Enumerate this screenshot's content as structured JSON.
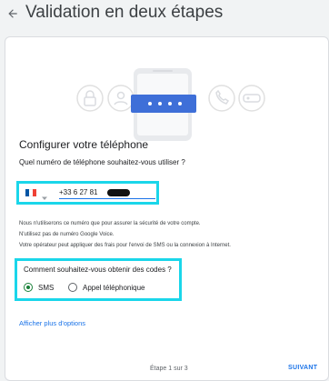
{
  "header": {
    "title": "Validation en deux étapes"
  },
  "setup": {
    "section_title": "Configurer votre téléphone",
    "question": "Quel numéro de téléphone souhaitez-vous utiliser ?",
    "country_flag": "france-flag-icon",
    "phone_value": "+33 6 27 81"
  },
  "info_lines": [
    "Nous n'utiliserons ce numéro que pour assurer la sécurité de votre compte.",
    "N'utilisez pas de numéro Google Voice.",
    "Votre opérateur peut appliquer des frais pour l'envoi de SMS ou la connexion à Internet."
  ],
  "codes": {
    "question": "Comment souhaitez-vous obtenir des codes ?",
    "options": [
      {
        "label": "SMS",
        "selected": true
      },
      {
        "label": "Appel téléphonique",
        "selected": false
      }
    ]
  },
  "more_options_label": "Afficher plus d'options",
  "footer": {
    "step_text": "Étape 1 sur 3",
    "next_label": "SUIVANT"
  },
  "colors": {
    "accent": "#1a73e8",
    "highlight": "#1ad6ea",
    "radio_selected": "#188038"
  }
}
